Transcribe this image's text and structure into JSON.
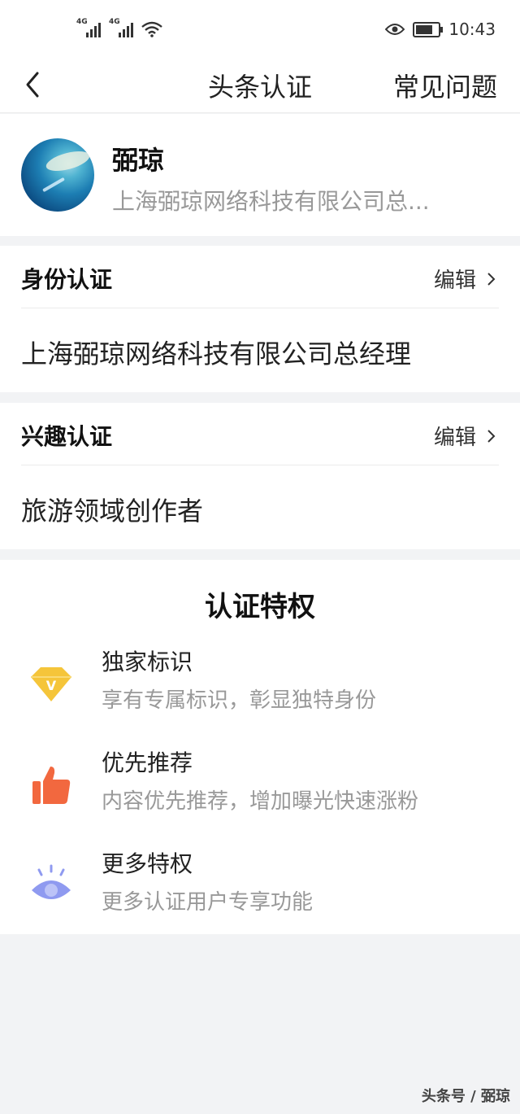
{
  "status_bar": {
    "signal1": "4G",
    "signal2": "4G",
    "time": "10:43"
  },
  "navbar": {
    "title": "头条认证",
    "faq": "常见问题"
  },
  "profile": {
    "name": "弼琼",
    "subtitle": "上海弼琼网络科技有限公司总..."
  },
  "identity": {
    "title": "身份认证",
    "edit": "编辑",
    "value": "上海弼琼网络科技有限公司总经理"
  },
  "interest": {
    "title": "兴趣认证",
    "edit": "编辑",
    "value": "旅游领域创作者"
  },
  "privileges": {
    "title": "认证特权",
    "items": [
      {
        "icon": "diamond-icon",
        "title": "独家标识",
        "desc": "享有专属标识，彰显独特身份",
        "color": "#f5c53a"
      },
      {
        "icon": "thumbs-up-icon",
        "title": "优先推荐",
        "desc": "内容优先推荐，增加曝光快速涨粉",
        "color": "#f2683f"
      },
      {
        "icon": "eye-icon",
        "title": "更多特权",
        "desc": "更多认证用户专享功能",
        "color": "#8f9af0"
      }
    ]
  },
  "watermark": "头条号 / 弼琼"
}
